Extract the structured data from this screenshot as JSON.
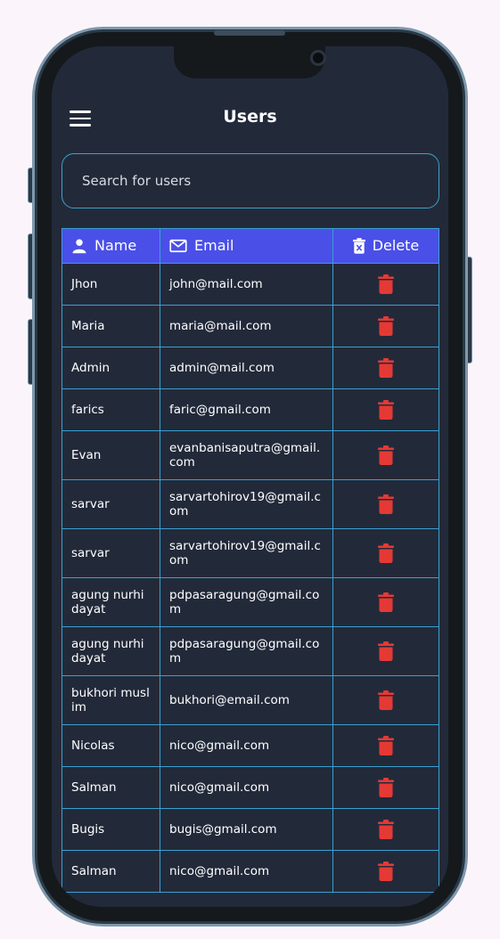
{
  "app": {
    "title": "Users"
  },
  "search": {
    "placeholder": "Search for users"
  },
  "table": {
    "columns": [
      {
        "label": "Name",
        "icon": "person-icon"
      },
      {
        "label": "Email",
        "icon": "mail-icon"
      },
      {
        "label": "Delete",
        "icon": "delete-icon"
      }
    ],
    "rows": [
      {
        "name": "Jhon",
        "email": "john@mail.com"
      },
      {
        "name": "Maria",
        "email": "maria@mail.com"
      },
      {
        "name": "Admin",
        "email": "admin@mail.com"
      },
      {
        "name": "farics",
        "email": "faric@gmail.com"
      },
      {
        "name": "Evan",
        "email": "evanbanisaputra@gmail.com"
      },
      {
        "name": "sarvar",
        "email": "sarvartohirov19@gmail.com"
      },
      {
        "name": "sarvar",
        "email": "sarvartohirov19@gmail.com"
      },
      {
        "name": "agung nurhidayat",
        "email": "pdpasaragung@gmail.com"
      },
      {
        "name": "agung nurhidayat",
        "email": "pdpasaragung@gmail.com"
      },
      {
        "name": "bukhori muslim",
        "email": "bukhori@email.com"
      },
      {
        "name": "Nicolas",
        "email": "nico@gmail.com"
      },
      {
        "name": "Salman",
        "email": "nico@gmail.com"
      },
      {
        "name": "Bugis",
        "email": "bugis@gmail.com"
      },
      {
        "name": "Salman",
        "email": "nico@gmail.com"
      }
    ]
  },
  "colors": {
    "background": "#222a3a",
    "header": "#4a4fe8",
    "border": "#3aa0d0",
    "delete": "#e53935"
  }
}
